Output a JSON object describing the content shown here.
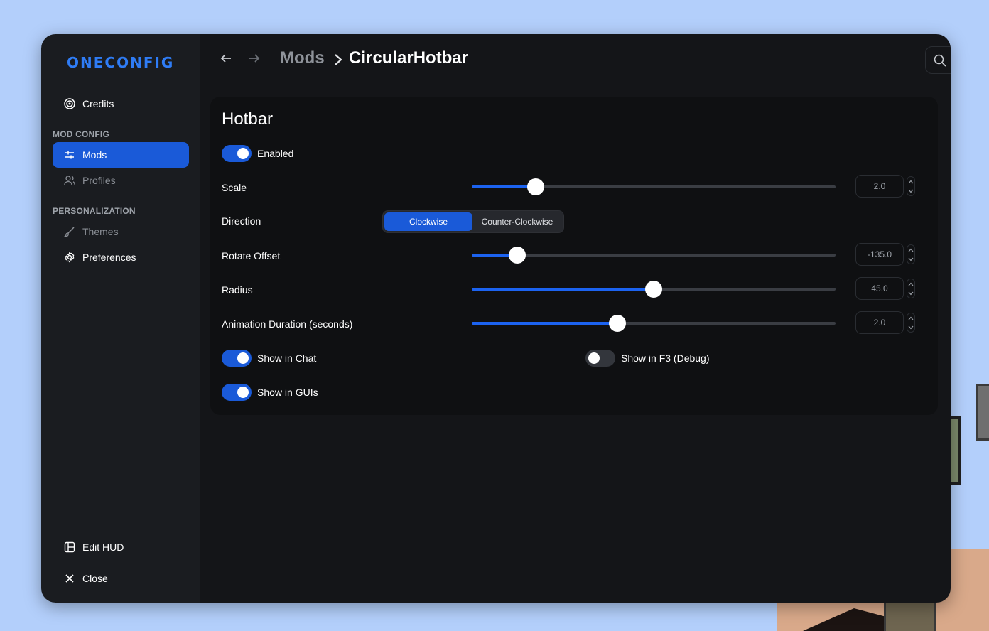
{
  "sidebar": {
    "logo": "ONECONFIG",
    "credits": "Credits",
    "mod_config_section": "MOD CONFIG",
    "mods": "Mods",
    "profiles": "Profiles",
    "personalization_section": "PERSONALIZATION",
    "themes": "Themes",
    "preferences": "Preferences",
    "edit_hud": "Edit HUD",
    "close": "Close"
  },
  "header": {
    "breadcrumb_parent": "Mods",
    "breadcrumb_current": "CircularHotbar",
    "search_placeholder": "Search..."
  },
  "panel": {
    "title": "Hotbar",
    "enabled": {
      "label": "Enabled",
      "on": true
    },
    "scale": {
      "label": "Scale",
      "value": "2.0",
      "fraction": 0.175
    },
    "direction": {
      "label": "Direction",
      "options": [
        "Clockwise",
        "Counter-Clockwise"
      ],
      "selected": "Clockwise"
    },
    "rotate_offset": {
      "label": "Rotate Offset",
      "value": "-135.0",
      "fraction": 0.125
    },
    "radius": {
      "label": "Radius",
      "value": "45.0",
      "fraction": 0.5
    },
    "animation_duration": {
      "label": "Animation Duration (seconds)",
      "value": "2.0",
      "fraction": 0.4
    },
    "show_in_chat": {
      "label": "Show in Chat",
      "on": true
    },
    "show_in_f3": {
      "label": "Show in F3 (Debug)",
      "on": false
    },
    "show_in_guis": {
      "label": "Show in GUIs",
      "on": true
    }
  },
  "colors": {
    "accent": "#1a5ad8",
    "sidebar_bg": "#1a1c20",
    "main_bg": "#141518",
    "panel_bg": "#0f1012",
    "page_bg": "#b3cffb"
  },
  "icons": [
    "credits-icon",
    "sliders-icon",
    "profiles-icon",
    "brush-icon",
    "gear-icon",
    "edit-hud-icon",
    "close-icon",
    "back-arrow-icon",
    "forward-arrow-icon",
    "chevron-right-icon",
    "search-icon",
    "chevron-up-icon",
    "chevron-down-icon"
  ]
}
